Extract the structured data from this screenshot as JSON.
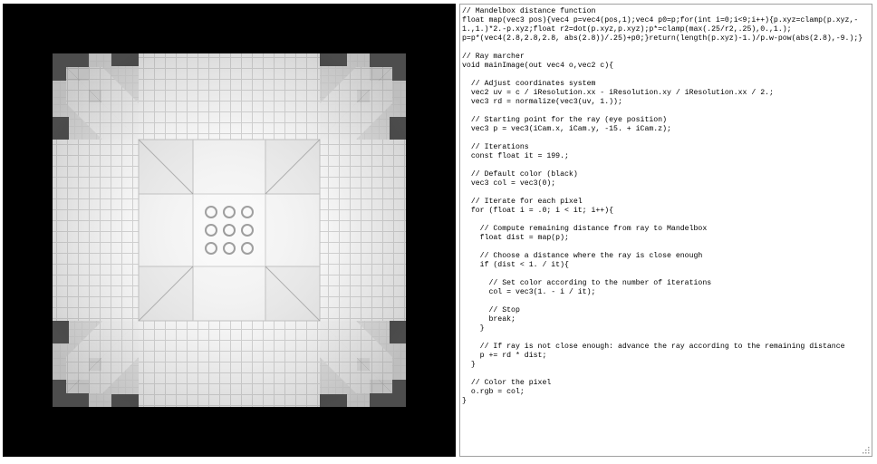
{
  "render": {
    "description_icon": "mandelbox-render",
    "background_color": "#000000",
    "surface_color": "#f2f2f2"
  },
  "editor": {
    "lines": [
      "// Mandelbox distance function",
      "float map(vec3 pos){vec4 p=vec4(pos,1);vec4 p0=p;for(int i=0;i<9;i++){p.xyz=clamp(p.xyz,-",
      "1.,1.)*2.-p.xyz;float r2=dot(p.xyz,p.xyz);p*=clamp(max(.25/r2,.25),0.,1.);",
      "p=p*(vec4(2.8,2.8,2.8, abs(2.8))/.25)+p0;}return(length(p.xyz)-1.)/p.w-pow(abs(2.8),-9.);}",
      "",
      "// Ray marcher",
      "void mainImage(out vec4 o,vec2 c){",
      "",
      "  // Adjust coordinates system",
      "  vec2 uv = c / iResolution.xx - iResolution.xy / iResolution.xx / 2.;",
      "  vec3 rd = normalize(vec3(uv, 1.));",
      "",
      "  // Starting point for the ray (eye position)",
      "  vec3 p = vec3(iCam.x, iCam.y, -15. + iCam.z);",
      "",
      "  // Iterations",
      "  const float it = 199.;",
      "",
      "  // Default color (black)",
      "  vec3 col = vec3(0);",
      "",
      "  // Iterate for each pixel",
      "  for (float i = .0; i < it; i++){",
      "",
      "    // Compute remaining distance from ray to Mandelbox",
      "    float dist = map(p);",
      "",
      "    // Choose a distance where the ray is close enough",
      "    if (dist < 1. / it){",
      "",
      "      // Set color according to the number of iterations",
      "      col = vec3(1. - i / it);",
      "",
      "      // Stop",
      "      break;",
      "    }",
      "",
      "    // If ray is not close enough: advance the ray according to the remaining distance",
      "    p += rd * dist;",
      "  }",
      "",
      "  // Color the pixel",
      "  o.rgb = col;",
      "}"
    ]
  }
}
